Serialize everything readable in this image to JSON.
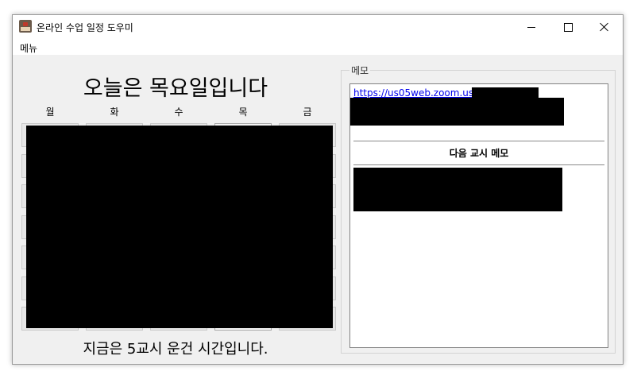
{
  "window": {
    "title": "온라인 수업 일정 도우미"
  },
  "menubar": {
    "menu_label": "메뉴"
  },
  "schedule": {
    "heading": "오늘은 목요일입니다",
    "days": [
      "월",
      "화",
      "수",
      "목",
      "금"
    ],
    "today_index": 3,
    "period_rows": 7,
    "status": "지금은 5교시 운건 시간입니다."
  },
  "memo": {
    "legend": "메모",
    "link_text": "https://us05web.zoom.us/j/",
    "next_heading": "다음 교시 메모"
  },
  "colors": {
    "window_bg": "#f0f0f0",
    "link": "#0000ee",
    "redaction": "#000000"
  }
}
